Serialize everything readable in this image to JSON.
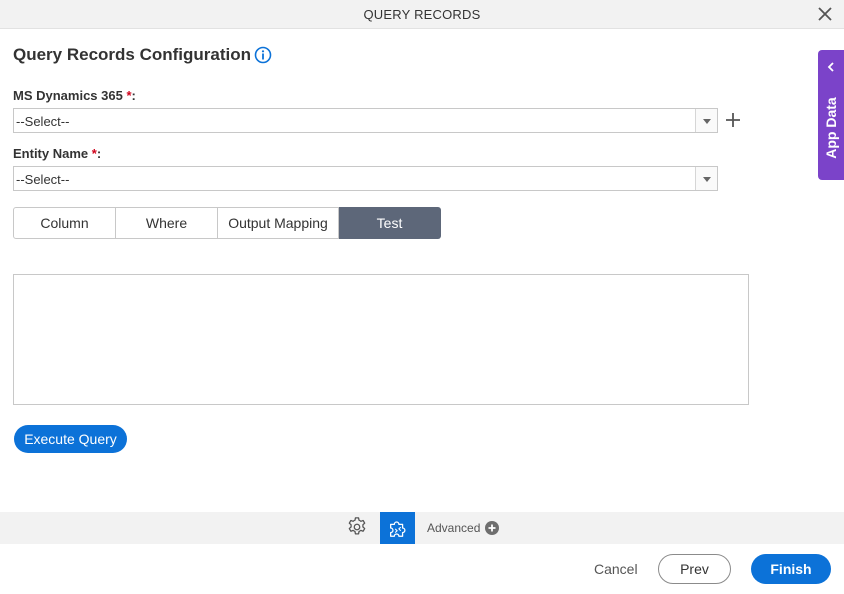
{
  "dialog": {
    "title": "QUERY RECORDS",
    "close_icon": "close-icon"
  },
  "config": {
    "title": "Query Records Configuration",
    "info_icon": "info-icon"
  },
  "fields": {
    "ms_dynamics": {
      "label": "MS Dynamics 365",
      "required_mark": "*",
      "suffix": ":",
      "value": "--Select--"
    },
    "entity_name": {
      "label": "Entity Name",
      "required_mark": "*",
      "suffix": ":",
      "value": "--Select--"
    }
  },
  "tabs": [
    {
      "label": "Column",
      "active": false
    },
    {
      "label": "Where",
      "active": false
    },
    {
      "label": "Output Mapping",
      "active": false
    },
    {
      "label": "Test",
      "active": true
    }
  ],
  "test": {
    "result_value": "",
    "execute_label": "Execute Query"
  },
  "app_data": {
    "label": "App Data"
  },
  "toolbar": {
    "advanced_label": "Advanced"
  },
  "footer": {
    "cancel_label": "Cancel",
    "prev_label": "Prev",
    "finish_label": "Finish"
  },
  "colors": {
    "primary": "#0c72d8",
    "active_tab": "#5d6779",
    "app_data": "#7b43c9",
    "required": "#d0021b"
  }
}
